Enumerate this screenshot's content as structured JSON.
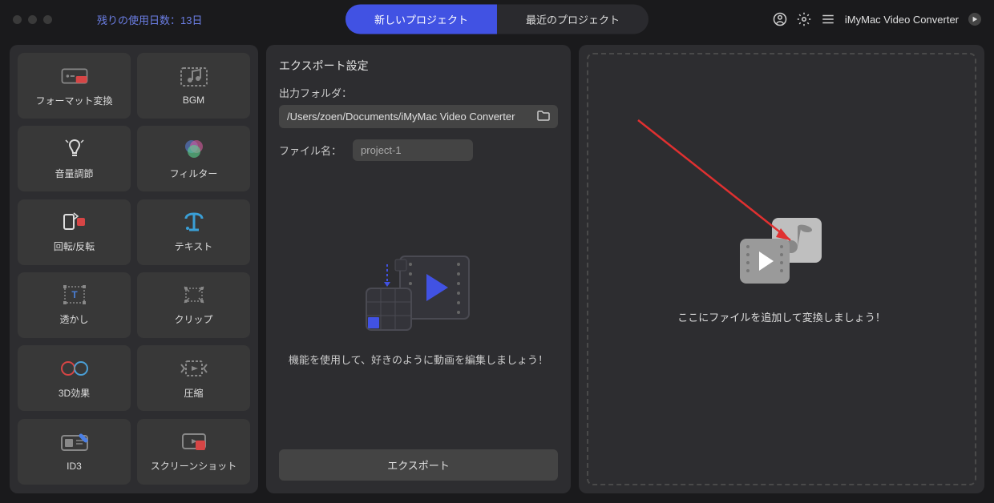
{
  "header": {
    "trial_text": "残りの使用日数：13日",
    "tab_new": "新しいプロジェクト",
    "tab_recent": "最近のプロジェクト",
    "app_name": "iMyMac Video Converter"
  },
  "sidebar": {
    "format_convert": "フォーマット変換",
    "bgm": "BGM",
    "volume": "音量調節",
    "filter": "フィルター",
    "rotate_flip": "回転/反転",
    "text": "テキスト",
    "watermark": "透かし",
    "clip": "クリップ",
    "threed": "3D効果",
    "compress": "圧縮",
    "id3": "ID3",
    "screenshot": "スクリーンショット"
  },
  "export": {
    "panel_title": "エクスポート設定",
    "output_folder_label": "出力フォルダ：",
    "output_folder_path": "/Users/zoen/Documents/iMyMac Video Converter",
    "filename_label": "ファイル名：",
    "filename_value": "project-1",
    "edit_caption": "機能を使用して、好きのように動画を編集しましょう！",
    "export_button": "エクスポート"
  },
  "dropzone": {
    "caption": "ここにファイルを追加して変換しましょう！"
  }
}
